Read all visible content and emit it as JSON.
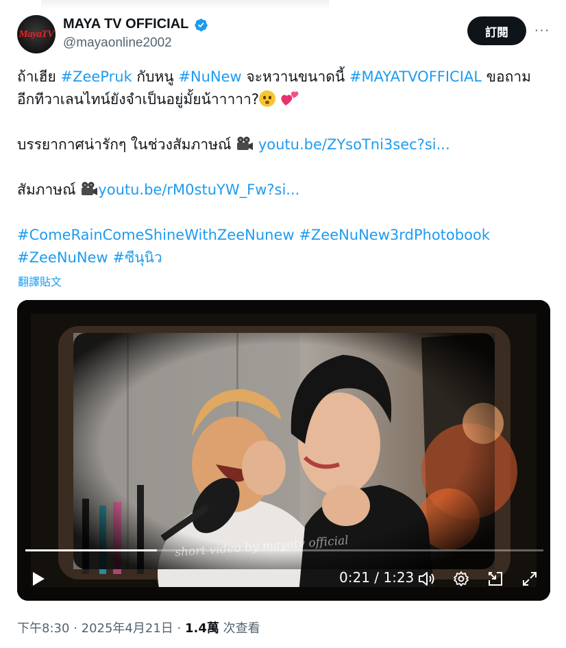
{
  "account": {
    "avatar_text": "MayaTV",
    "name": "MAYA TV OFFICIAL",
    "handle": "@mayaonline2002",
    "verified": true
  },
  "actions": {
    "subscribe_label": "訂閱",
    "more_label": "···"
  },
  "post": {
    "line1": {
      "t1": "ถ้าเฮีย ",
      "h1": "#ZeePruk",
      "t2": " กับหนู ",
      "h2": "#NuNew",
      "t3": " จะหวานขนาดนี้ ",
      "h3": "#MAYATVOFFICIAL",
      "t4": " ขอถาม"
    },
    "line2": "อีกทีวาเลนไทน์ยังจำเป็นอยู่มั้ยน้าาาาา?",
    "line3": {
      "text": "บรรยากาศน่ารักๆ ในช่วงสัมภาษณ์ ",
      "link": "youtu.be/ZYsoTni3sec?si..."
    },
    "line4": {
      "text": "สัมภาษณ์ ",
      "link": "youtu.be/rM0stuYW_Fw?si..."
    },
    "hashtags1": {
      "h1": "#ComeRainComeShineWithZeeNunew",
      "h2": "#ZeeNuNew3rdPhotobook"
    },
    "hashtags2": {
      "h1": "#ZeeNuNew",
      "h2": "#ซีนุนิว"
    },
    "translate_label": "翻譯貼文"
  },
  "video": {
    "watermark": "short video by mayatv official",
    "current_time": "0:21",
    "duration": "1:23",
    "time_display": "0:21 / 1:23",
    "progress": 0.254
  },
  "meta": {
    "time": "下午8:30",
    "date": "2025年4月21日",
    "views": "1.4萬",
    "views_label": "次查看",
    "separator": "·"
  },
  "colors": {
    "link": "#1d9bf0",
    "text": "#0f1419",
    "secondary": "#536471",
    "button_bg": "#0f1419",
    "verified": "#1d9bf0"
  },
  "icons": [
    "verified-badge-icon",
    "more-icon",
    "smile-emoji-icon",
    "hearts-emoji-icon",
    "movie-camera-icon",
    "play-icon",
    "volume-icon",
    "settings-gear-icon",
    "dock-icon",
    "fullscreen-icon"
  ]
}
